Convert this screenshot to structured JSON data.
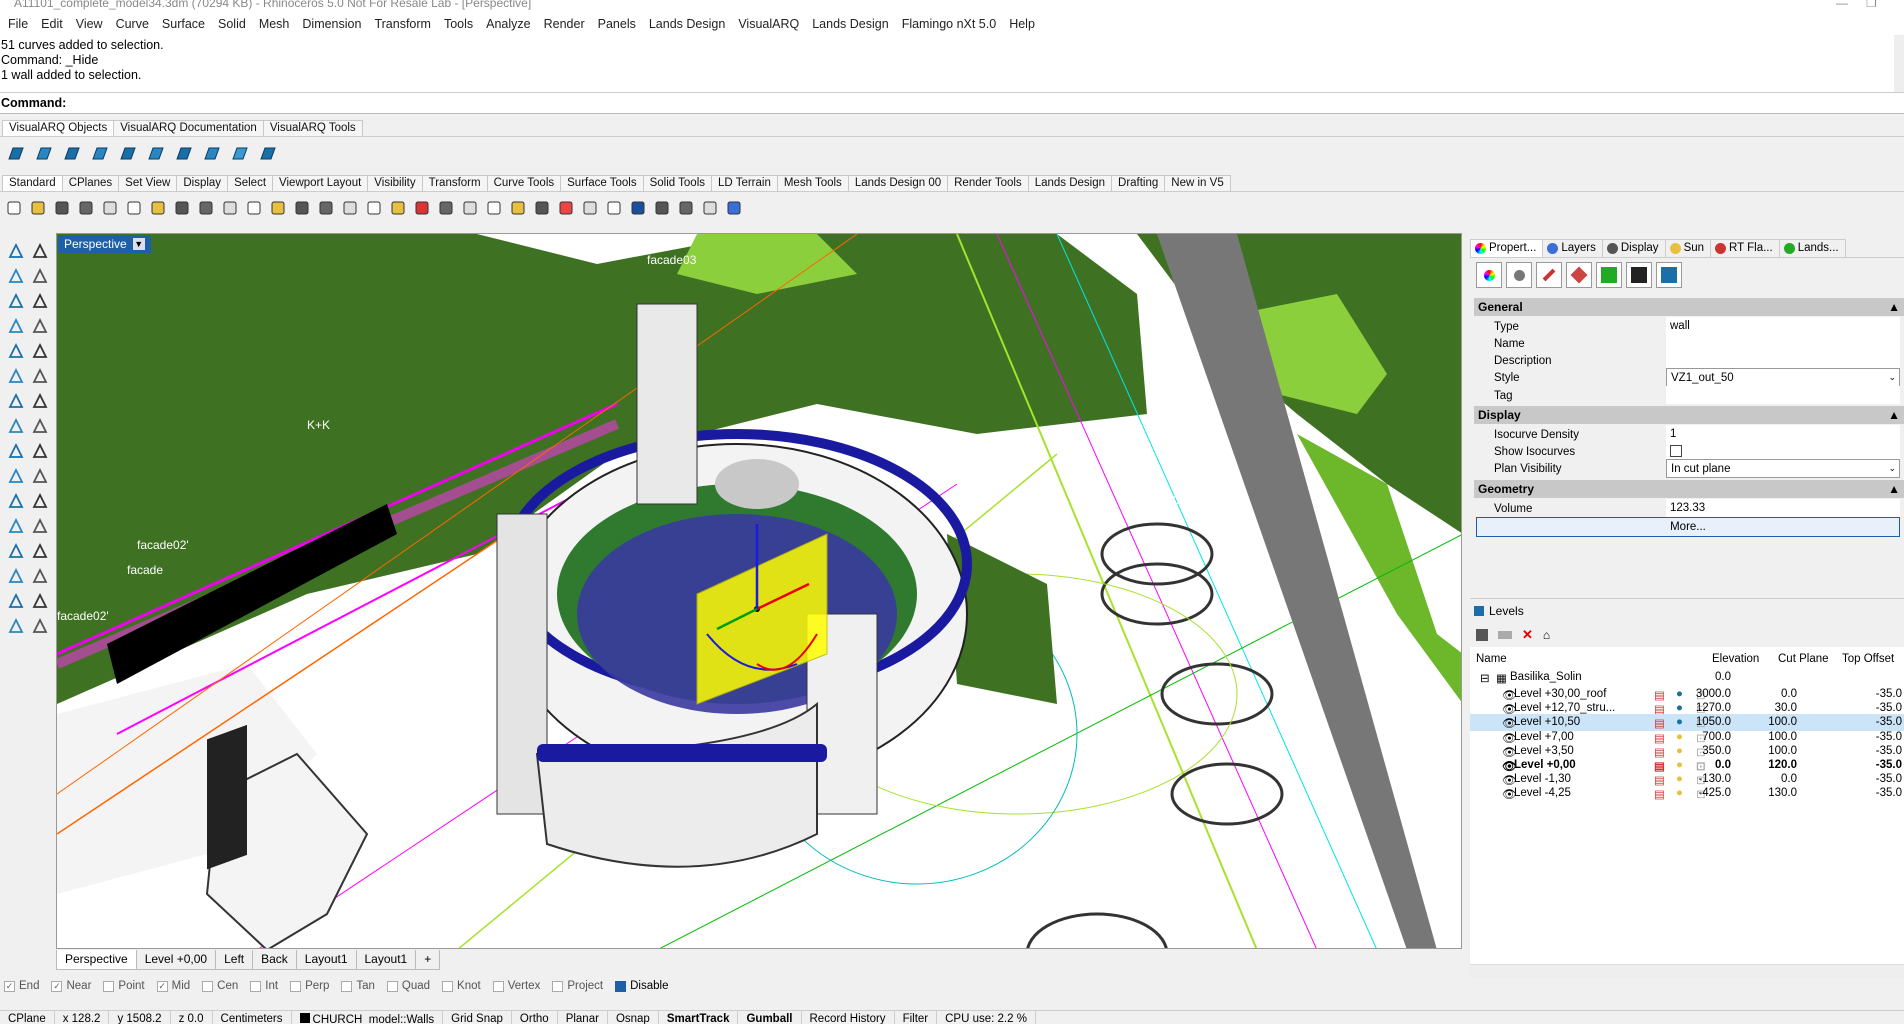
{
  "window": {
    "title": "A11101_complete_model34.3dm (70294 KB) - Rhinoceros 5.0 Not For Resale Lab - [Perspective]"
  },
  "menu": [
    "File",
    "Edit",
    "View",
    "Curve",
    "Surface",
    "Solid",
    "Mesh",
    "Dimension",
    "Transform",
    "Tools",
    "Analyze",
    "Render",
    "Panels",
    "Lands Design",
    "VisualARQ",
    "Lands Design",
    "Flamingo nXt 5.0",
    "Help"
  ],
  "history": [
    "51 curves added to selection.",
    "Command: _Hide",
    "1 wall added to selection."
  ],
  "command": {
    "label": "Command:"
  },
  "toolbar_tabs_top": [
    "VisualARQ Objects",
    "VisualARQ Documentation",
    "VisualARQ Tools"
  ],
  "toolbar_tabs_main": [
    "Standard",
    "CPlanes",
    "Set View",
    "Display",
    "Select",
    "Viewport Layout",
    "Visibility",
    "Transform",
    "Curve Tools",
    "Surface Tools",
    "Solid Tools",
    "LD Terrain",
    "Mesh Tools",
    "Lands Design 00",
    "Render Tools",
    "Lands Design",
    "Drafting",
    "New in V5"
  ],
  "viewport": {
    "label": "Perspective",
    "tabs": [
      "Perspective",
      "Level +0,00",
      "Left",
      "Back",
      "Layout1",
      "Layout1"
    ],
    "add_tab": "+",
    "scene_labels": [
      "facade",
      "facade03",
      "facade02'",
      "facade",
      "facade02'",
      "K+K",
      "facade03"
    ]
  },
  "osnap": {
    "items": [
      {
        "label": "End",
        "checked": true
      },
      {
        "label": "Near",
        "checked": true
      },
      {
        "label": "Point",
        "checked": false
      },
      {
        "label": "Mid",
        "checked": true
      },
      {
        "label": "Cen",
        "checked": false
      },
      {
        "label": "Int",
        "checked": false
      },
      {
        "label": "Perp",
        "checked": false
      },
      {
        "label": "Tan",
        "checked": false
      },
      {
        "label": "Quad",
        "checked": false
      },
      {
        "label": "Knot",
        "checked": false
      },
      {
        "label": "Vertex",
        "checked": false
      },
      {
        "label": "Project",
        "checked": false
      },
      {
        "label": "Disable",
        "checked": false
      }
    ]
  },
  "status": {
    "cplane": "CPlane",
    "x": "x 128.2",
    "y": "y 1508.2",
    "z": "z 0.0",
    "units": "Centimeters",
    "layer": "CHURCH_model::Walls",
    "grid_snap": "Grid Snap",
    "ortho": "Ortho",
    "planar": "Planar",
    "osnap": "Osnap",
    "smarttrack": "SmartTrack",
    "gumball": "Gumball",
    "record_history": "Record History",
    "filter": "Filter",
    "cpu": "CPU use: 2.2 %"
  },
  "panel_tabs": [
    "Propert...",
    "Layers",
    "Display",
    "Sun",
    "RT Fla...",
    "Lands..."
  ],
  "properties": {
    "general_header": "General",
    "type_label": "Type",
    "type_value": "wall",
    "name_label": "Name",
    "name_value": "",
    "desc_label": "Description",
    "desc_value": "",
    "style_label": "Style",
    "style_value": "VZ1_out_50",
    "tag_label": "Tag",
    "tag_value": "",
    "display_header": "Display",
    "isodens_label": "Isocurve Density",
    "isodens_value": "1",
    "showiso_label": "Show Isocurves",
    "planvis_label": "Plan Visibility",
    "planvis_value": "In cut plane",
    "geometry_header": "Geometry",
    "volume_label": "Volume",
    "volume_value": "123.33",
    "more_label": "More..."
  },
  "levels": {
    "title": "Levels",
    "columns": [
      "Name",
      "Elevation",
      "Cut Plane",
      "Top Offset"
    ],
    "root": "Basilika_Solin",
    "root_elev": "0.0",
    "rows": [
      {
        "name": "Level +30,00_roof",
        "elev": "3000.0",
        "cut": "0.0",
        "top": "-35.0",
        "bold": false,
        "sel": false
      },
      {
        "name": "Level +12,70_stru...",
        "elev": "1270.0",
        "cut": "30.0",
        "top": "-35.0",
        "bold": false,
        "sel": false
      },
      {
        "name": "Level +10,50",
        "elev": "1050.0",
        "cut": "100.0",
        "top": "-35.0",
        "bold": false,
        "sel": true
      },
      {
        "name": "Level +7,00",
        "elev": "700.0",
        "cut": "100.0",
        "top": "-35.0",
        "bold": false,
        "sel": false
      },
      {
        "name": "Level +3,50",
        "elev": "350.0",
        "cut": "100.0",
        "top": "-35.0",
        "bold": false,
        "sel": false
      },
      {
        "name": "Level +0,00",
        "elev": "0.0",
        "cut": "120.0",
        "top": "-35.0",
        "bold": true,
        "sel": false
      },
      {
        "name": "Level -1,30",
        "elev": "-130.0",
        "cut": "0.0",
        "top": "-35.0",
        "bold": false,
        "sel": false
      },
      {
        "name": "Level -4,25",
        "elev": "-425.0",
        "cut": "130.0",
        "top": "-35.0",
        "bold": false,
        "sel": false
      }
    ]
  },
  "colors": {
    "accent": "#1f5fa8",
    "terrain": "#3a6e1f",
    "selection": "#ffff00"
  }
}
